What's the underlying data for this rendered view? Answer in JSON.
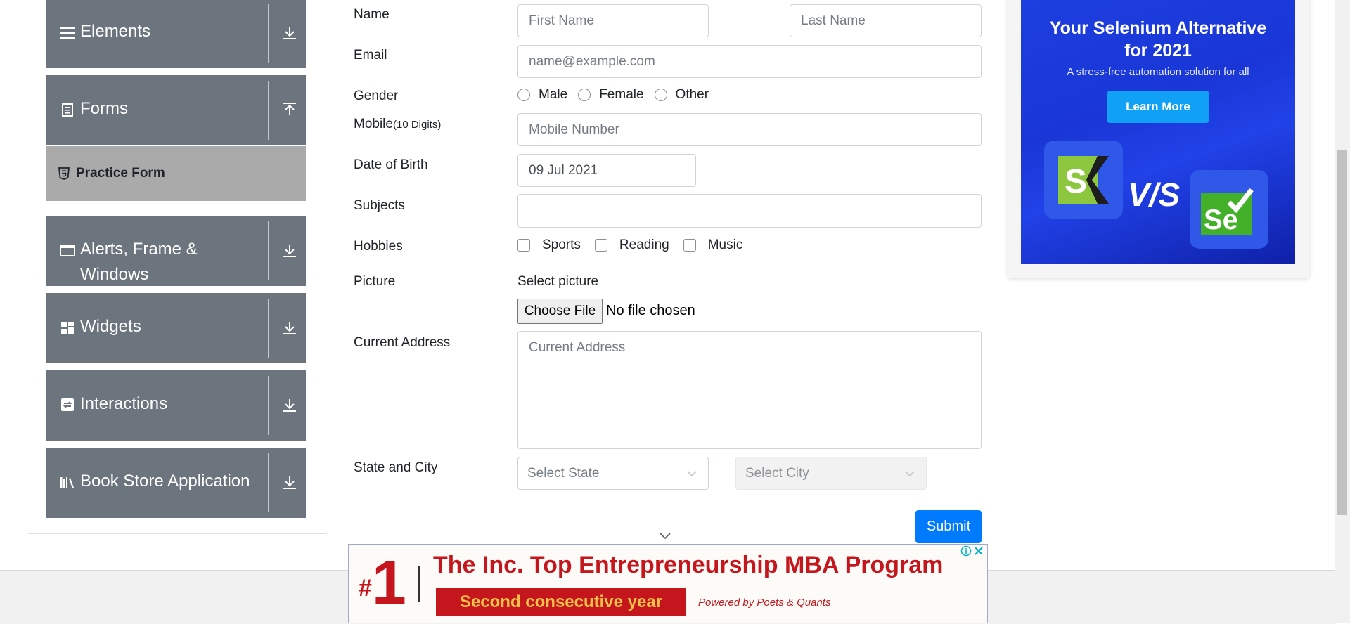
{
  "sidebar": {
    "groups": [
      {
        "label": "Elements",
        "icon": "hamburger-icon",
        "arrow": "download-arrow-icon"
      },
      {
        "label": "Forms",
        "icon": "document-icon",
        "arrow": "upload-arrow-icon"
      },
      {
        "label": "Alerts, Frame & Windows",
        "icon": "window-icon",
        "arrow": "download-arrow-icon"
      },
      {
        "label": "Widgets",
        "icon": "widgets-icon",
        "arrow": "download-arrow-icon"
      },
      {
        "label": "Interactions",
        "icon": "interactions-icon",
        "arrow": "download-arrow-icon"
      },
      {
        "label": "Book Store Application",
        "icon": "books-icon",
        "arrow": "download-arrow-icon"
      }
    ],
    "active_item": {
      "label": "Practice Form",
      "icon": "html5-icon"
    }
  },
  "form": {
    "name_label": "Name",
    "first_name_placeholder": "First Name",
    "last_name_placeholder": "Last Name",
    "email_label": "Email",
    "email_placeholder": "name@example.com",
    "gender_label": "Gender",
    "gender_options": [
      "Male",
      "Female",
      "Other"
    ],
    "mobile_label": "Mobile",
    "mobile_hint": "(10 Digits)",
    "mobile_placeholder": "Mobile Number",
    "dob_label": "Date of Birth",
    "dob_value": "09 Jul 2021",
    "subjects_label": "Subjects",
    "subjects_value": "",
    "hobbies_label": "Hobbies",
    "hobbies_options": [
      "Sports",
      "Reading",
      "Music"
    ],
    "picture_label": "Picture",
    "select_picture_label": "Select picture",
    "choose_file_label": "Choose File",
    "file_status": "No file chosen",
    "address_label": "Current Address",
    "address_placeholder": "Current Address",
    "state_city_label": "State and City",
    "state_placeholder": "Select State",
    "city_placeholder": "Select City",
    "submit_label": "Submit"
  },
  "right_ad": {
    "title_line1": "Your Selenium Alternative",
    "title_line2": "for 2021",
    "subtitle": "A stress-free automation solution for all",
    "button": "Learn More",
    "vs_text": "V/S",
    "logo_left_text": "S",
    "logo_right_text": "Se",
    "colors": {
      "background": "#1d3fe0",
      "button": "#10a0f5"
    }
  },
  "bottom_ad": {
    "rank_hash": "#",
    "rank_number": "1",
    "headline": "The Inc. Top Entrepreneurship MBA Program",
    "banner": "Second consecutive year",
    "powered_by": "Powered by Poets & Quants",
    "colors": {
      "primary": "#c4161c",
      "banner_text": "#f3c14a"
    }
  },
  "colors": {
    "sidebar_group": "#6c757d",
    "active_item": "#aaaaaa",
    "submit": "#007bff"
  }
}
